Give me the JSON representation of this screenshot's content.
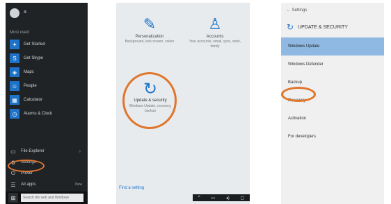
{
  "panel1": {
    "user_name": "a",
    "section_label": "Most used",
    "apps": [
      {
        "label": "Get Started",
        "icon": "lightbulb-icon"
      },
      {
        "label": "Get Skype",
        "icon": "skype-icon"
      },
      {
        "label": "Maps",
        "icon": "map-icon"
      },
      {
        "label": "People",
        "icon": "people-icon"
      },
      {
        "label": "Calculator",
        "icon": "calculator-icon"
      },
      {
        "label": "Alarms & Clock",
        "icon": "clock-icon"
      }
    ],
    "bottom_items": [
      {
        "label": "File Explorer",
        "icon": "folder-icon",
        "trailing": "›"
      },
      {
        "label": "Settings",
        "icon": "gear-icon",
        "trailing": ""
      },
      {
        "label": "Power",
        "icon": "power-icon",
        "trailing": ""
      },
      {
        "label": "All apps",
        "icon": "apps-icon",
        "trailing": "New"
      }
    ],
    "search_placeholder": "Search the web and Windows"
  },
  "panel2": {
    "tiles": [
      {
        "title": "Personalization",
        "desc": "Background, lock screen, colors",
        "icon": "pen-icon"
      },
      {
        "title": "Accounts",
        "desc": "Your accounts, email, sync, work, family",
        "icon": "person-icon"
      }
    ],
    "update": {
      "title": "Update & security",
      "desc": "Windows Update, recovery, backup",
      "icon": "refresh-icon"
    },
    "bottom_link": "Find a setting",
    "taskbar_glyphs": [
      "^",
      "▭",
      "◂)",
      "▢"
    ]
  },
  "panel3": {
    "back_label": "←  Settings",
    "header_title": "UPDATE & SECURITY",
    "items": [
      {
        "label": "Windows Update",
        "selected": true
      },
      {
        "label": "Windows Defender",
        "selected": false
      },
      {
        "label": "Backup",
        "selected": false
      },
      {
        "label": "Recovery",
        "selected": false
      },
      {
        "label": "Activation",
        "selected": false
      },
      {
        "label": "For developers",
        "selected": false
      }
    ]
  },
  "colors": {
    "accent": "#1e73c8",
    "highlight_ring": "#e0752c",
    "selected_row": "#8fb9e3",
    "start_menu_bg": "#1f2326"
  }
}
